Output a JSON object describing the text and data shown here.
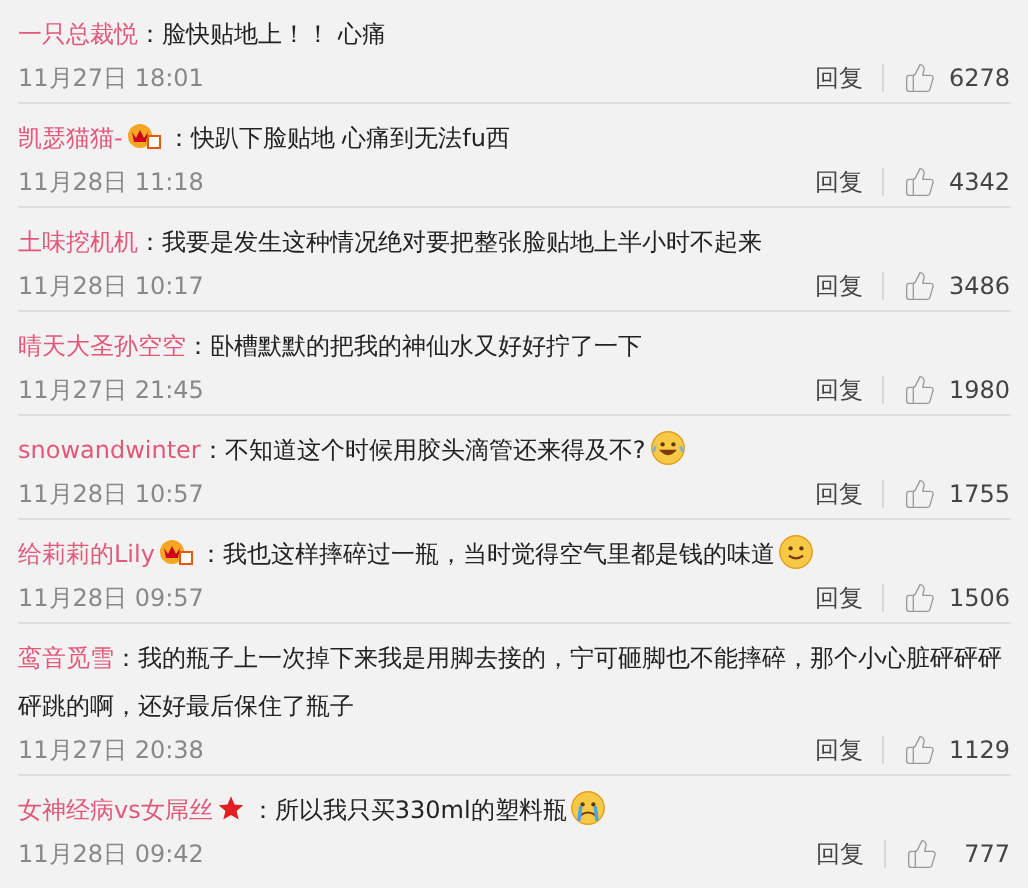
{
  "comments": [
    {
      "user": "一只总裁悦",
      "text": "：脸快贴地上！！ 心痛",
      "date": "11月27日 18:01",
      "reply": "回复",
      "likes": "6278"
    },
    {
      "user": "凯瑟猫猫-",
      "badge": {
        "kind": "vip"
      },
      "text": "：快趴下脸贴地 心痛到无法fu西",
      "date": "11月28日 11:18",
      "reply": "回复",
      "likes": "4342"
    },
    {
      "user": "土味挖机机",
      "text": "：我要是发生这种情况绝对要把整张脸贴地上半小时不起来",
      "date": "11月28日 10:17",
      "reply": "回复",
      "likes": "3486"
    },
    {
      "user": "晴天大圣孙空空",
      "text": "：卧槽默默的把我的神仙水又好好拧了一下",
      "date": "11月27日 21:45",
      "reply": "回复",
      "likes": "1980"
    },
    {
      "user": "snowandwinter",
      "text": "：不知道这个时候用胶头滴管还来得及不?",
      "emoji": {
        "kind": "laugh"
      },
      "date": "11月28日 10:57",
      "reply": "回复",
      "likes": "1755"
    },
    {
      "user": "给莉莉的Lily",
      "badge": {
        "kind": "vip"
      },
      "text": "：我也这样摔碎过一瓶，当时觉得空气里都是钱的味道",
      "emoji": {
        "kind": "smile"
      },
      "date": "11月28日 09:57",
      "reply": "回复",
      "likes": "1506"
    },
    {
      "user": "鸾音觅雪",
      "text": "：我的瓶子上一次掉下来我是用脚去接的，宁可砸脚也不能摔碎，那个小心脏砰砰砰砰跳的啊，还好最后保住了瓶子",
      "date": "11月27日 20:38",
      "reply": "回复",
      "likes": "1129"
    },
    {
      "user": "女神经病vs女屌丝",
      "badge": {
        "kind": "star"
      },
      "text": "：所以我只买330ml的塑料瓶",
      "emoji": {
        "kind": "cry"
      },
      "date": "11月28日 09:42",
      "reply": "回复",
      "likes": "777"
    }
  ]
}
